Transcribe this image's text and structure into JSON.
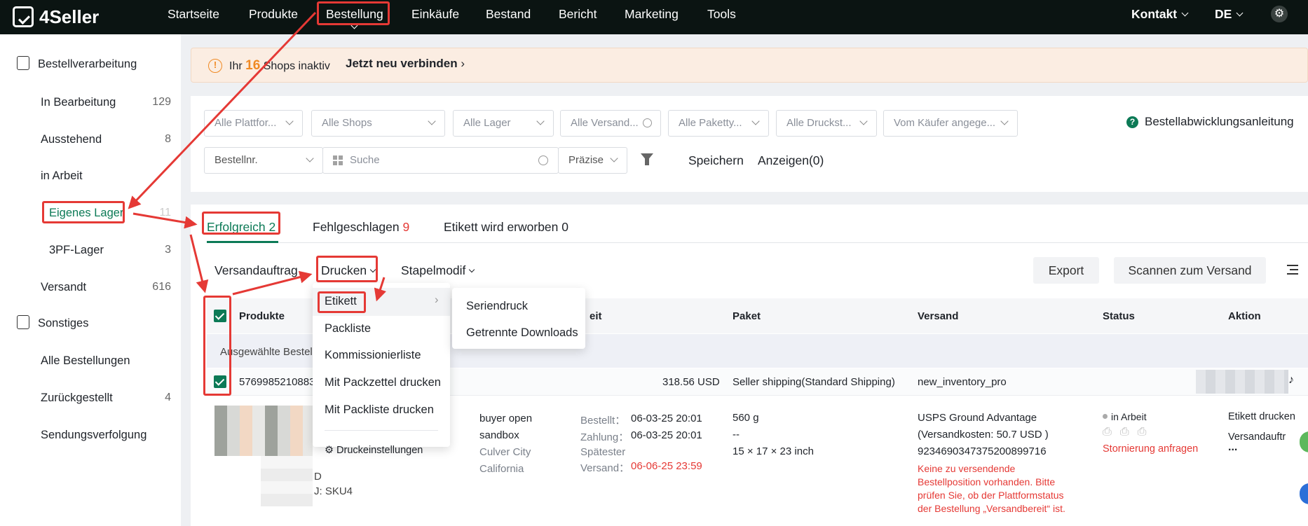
{
  "app": {
    "logo_text": "4Seller"
  },
  "nav": {
    "items": [
      "Startseite",
      "Produkte",
      "Bestellung",
      "Einkäufe",
      "Bestand",
      "Bericht",
      "Marketing",
      "Tools"
    ],
    "contact": "Kontakt",
    "language": "DE"
  },
  "sidebar": {
    "section1": "Bestellverarbeitung",
    "items": [
      {
        "label": "In Bearbeitung",
        "count": "129"
      },
      {
        "label": "Ausstehend",
        "count": "8"
      },
      {
        "label": "in Arbeit",
        "count": ""
      },
      {
        "label": "Eigenes Lager",
        "count": "11"
      },
      {
        "label": "3PF-Lager",
        "count": "3"
      },
      {
        "label": "Versandt",
        "count": "616"
      }
    ],
    "section2": "Sonstiges",
    "items2": [
      {
        "label": "Alle Bestellungen",
        "count": ""
      },
      {
        "label": "Zurückgestellt",
        "count": "4"
      },
      {
        "label": "Sendungsverfolgung",
        "count": ""
      }
    ]
  },
  "banner": {
    "prefix": "Ihr",
    "count": "16",
    "suffix": "Shops inaktiv",
    "link": "Jetzt neu verbinden"
  },
  "filters": {
    "row1": [
      "Alle Plattfor...",
      "Alle Shops",
      "Alle Lager",
      "Alle Versand...",
      "Alle Paketty...",
      "Alle Druckst...",
      "Vom Käufer angege..."
    ],
    "guide": "Bestellabwicklungsanleitung",
    "search_field": "Bestellnr.",
    "search_placeholder": "Suche",
    "precision": "Präzise",
    "save": "Speichern",
    "show": "Anzeigen(0)"
  },
  "tabs": [
    {
      "label": "Erfolgreich",
      "count": "2"
    },
    {
      "label": "Fehlgeschlagen",
      "count": "9"
    },
    {
      "label": "Etikett wird erworben",
      "count": "0"
    }
  ],
  "toolbar": {
    "shipping_order": "Versandauftrag",
    "print": "Drucken",
    "batch": "Stapelmodif",
    "export": "Export",
    "scan": "Scannen zum Versand"
  },
  "table": {
    "headers": [
      "Produkte",
      "eit",
      "Paket",
      "Versand",
      "Status",
      "Aktion"
    ],
    "selected_text": "Ausgewählte Bestell",
    "order_number": "5769985210883",
    "amount": "318.56 USD",
    "shipping_service": "Seller shipping(Standard Shipping)",
    "product_code": "new_inventory_pro",
    "row": {
      "sku_d": "D",
      "sku": "J: SKU4",
      "buyer": [
        "buyer open",
        "sandbox",
        "Culver City",
        "California"
      ],
      "ordered_label": "Bestellt：",
      "ordered": "06-03-25 20:01",
      "paid_label": "Zahlung：",
      "paid": "06-03-25 20:01",
      "latest_label": "Spätester",
      "ship_label": "Versand：",
      "ship_by": "06-06-25 23:59",
      "weight": "560 g",
      "dash": "--",
      "dims": "15 × 17 × 23 inch",
      "carrier": "USPS Ground Advantage",
      "cost": "(Versandkosten:  50.7 USD )",
      "tracking": "9234690347375200899716",
      "warning": [
        "Keine zu versendende",
        "Bestellposition vorhanden. Bitte",
        "prüfen Sie, ob der Plattformstatus",
        "der Bestellung „Versandbereit“ ist."
      ],
      "status": "in Arbeit",
      "cancel": "Stornierung anfragen",
      "action1": "Etikett drucken",
      "action2": "Versandauftr",
      "more": "..."
    }
  },
  "print_menu": {
    "items": [
      "Etikett",
      "Packliste",
      "Kommissionierliste",
      "Mit Packzettel drucken",
      "Mit Packliste drucken"
    ],
    "settings": "Druckeinstellungen",
    "submenu": [
      "Seriendruck",
      "Getrennte Downloads"
    ]
  },
  "colors": {
    "accent": "#0c7a56",
    "highlight": "#e53935",
    "topbar": "#0b1412",
    "warning": "#f08a24"
  }
}
